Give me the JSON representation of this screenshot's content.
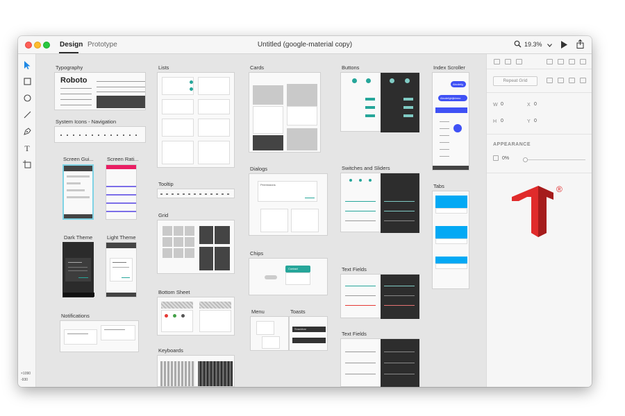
{
  "window": {
    "tabs": [
      "Design",
      "Prototype"
    ],
    "title": "Untitled (google-material copy)",
    "zoom": "19.3%",
    "coords": {
      "x": "×1090",
      "y": "-930"
    }
  },
  "artboards": [
    {
      "id": "typography",
      "label": "Typography"
    },
    {
      "id": "system-icons",
      "label": "System Icons - Navigation"
    },
    {
      "id": "screen-guides",
      "label": "Screen Gui..."
    },
    {
      "id": "screen-ratios",
      "label": "Screen Rati..."
    },
    {
      "id": "dark-theme",
      "label": "Dark Theme"
    },
    {
      "id": "light-theme",
      "label": "Light Theme"
    },
    {
      "id": "notifications",
      "label": "Notifications"
    },
    {
      "id": "lists",
      "label": "Lists"
    },
    {
      "id": "tooltip",
      "label": "Tooltip"
    },
    {
      "id": "grid",
      "label": "Grid"
    },
    {
      "id": "bottom-sheet",
      "label": "Bottom Sheet"
    },
    {
      "id": "keyboards",
      "label": "Keyboards"
    },
    {
      "id": "cards",
      "label": "Cards"
    },
    {
      "id": "dialogs",
      "label": "Dialogs"
    },
    {
      "id": "chips",
      "label": "Chips"
    },
    {
      "id": "menu",
      "label": "Menu"
    },
    {
      "id": "toasts",
      "label": "Toasts"
    },
    {
      "id": "buttons",
      "label": "Buttons"
    },
    {
      "id": "switches",
      "label": "Switches and Sliders"
    },
    {
      "id": "text-fields-1",
      "label": "Text Fields"
    },
    {
      "id": "text-fields-2",
      "label": "Text Fields"
    },
    {
      "id": "index-scroller",
      "label": "Index Scroller"
    },
    {
      "id": "tabs",
      "label": "Tabs"
    }
  ],
  "artboard_text": {
    "roboto": "Roboto",
    "dialog_title": "Permissions",
    "toast_text": "Snackbar",
    "chip_label": "Contact",
    "pill_1": "Abcdefg",
    "pill_2": "Abcdefghijklmno"
  },
  "inspector": {
    "repeat_grid": "Repeat Grid",
    "w_label": "W",
    "w_val": "0",
    "x_label": "X",
    "x_val": "0",
    "h_label": "H",
    "h_val": "0",
    "y_label": "Y",
    "y_val": "0",
    "appearance": "APPEARANCE",
    "opacity": "0%"
  },
  "colors": {
    "accent": "#26a69a",
    "logo_red": "#e02b2b",
    "logo_dark_red": "#a51c1c"
  },
  "icons": {
    "search": "search-icon",
    "play": "play-icon",
    "share": "share-icon",
    "logo_mark": "registered-mark"
  },
  "logo": {
    "registered": "®"
  }
}
